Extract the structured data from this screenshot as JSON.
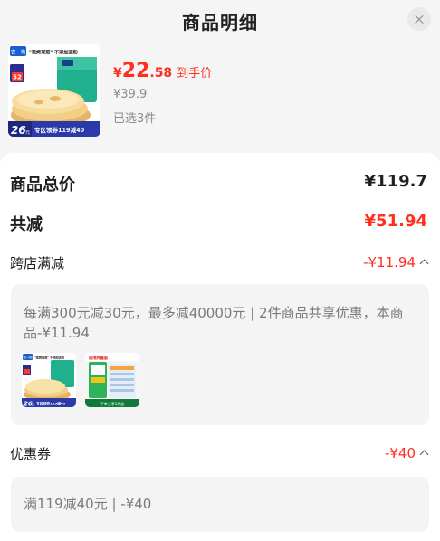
{
  "header": {
    "title": "商品明细"
  },
  "product": {
    "price_symbol": "¥",
    "price_int": "22",
    "price_dec": ".58",
    "price_tag": "到手价",
    "original_price": "¥39.9",
    "selected_count": "已选3件",
    "image_text": {
      "brand": "农一狗",
      "slogan": "\"现烤现煎\" 不添加泥粉",
      "badge_num": "52",
      "bottom_num": "26",
      "bottom_unit": "元",
      "bottom_text": "专区领券119减40"
    }
  },
  "summary": {
    "total_label": "商品总价",
    "total_value": "¥119.7",
    "discount_label": "共减",
    "discount_value": "¥51.94"
  },
  "cross_store": {
    "label": "跨店满减",
    "value": "-¥11.94",
    "description": "每满300元减30元，最多减40000元 | 2件商品共享优惠，本商品-¥11.94",
    "thumb1": {
      "brand": "农一狗",
      "slogan": "\"现烤现煎\" 不添加泥粉",
      "bottom_num": "26",
      "bottom_unit": "元",
      "bottom_text": "专区领券119减40"
    },
    "thumb2": {
      "top_text": "极限炸酱面",
      "bottom_text": "下单立享5折起"
    }
  },
  "coupon": {
    "label": "优惠券",
    "value": "-¥40",
    "description": "满119减40元 | -¥40"
  },
  "colors": {
    "accent_red": "#ff2e1f",
    "panel_bg": "#ffffff",
    "page_bg": "#f5f5f5"
  }
}
